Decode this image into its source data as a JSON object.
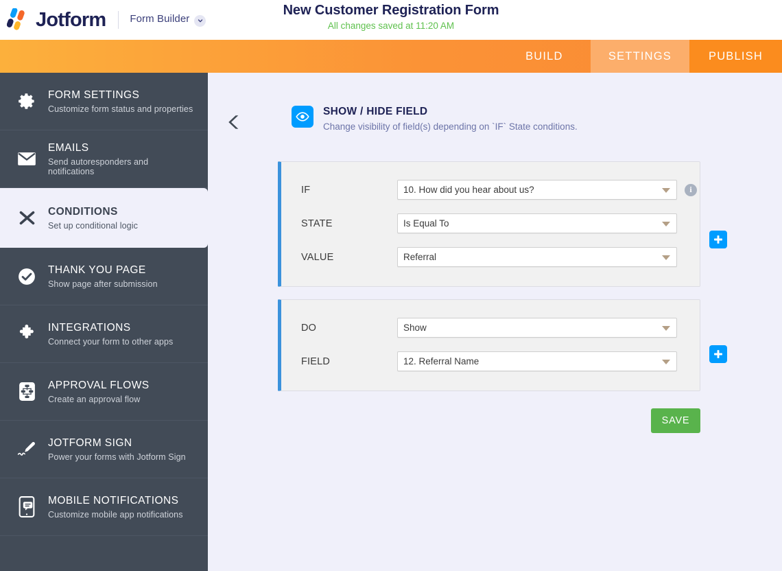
{
  "header": {
    "logo_text": "Jotform",
    "logo_icon": "jotform-logo-icon",
    "builder_label": "Form Builder",
    "builder_chevron_icon": "chevron-down-icon",
    "form_title": "New Customer Registration Form",
    "save_status": "All changes saved at 11:20 AM",
    "status_color": "#5fc14e",
    "title_color": "#1e2255"
  },
  "nav": {
    "tabs": [
      {
        "label": "BUILD",
        "active": false
      },
      {
        "label": "SETTINGS",
        "active": true
      },
      {
        "label": "PUBLISH",
        "active": false
      }
    ],
    "accent_color": "#fb9236",
    "active_tab_color": "#fcae6b"
  },
  "sidebar": {
    "items": [
      {
        "title": "FORM SETTINGS",
        "subtitle": "Customize form status and properties",
        "icon": "gear-icon",
        "active": false
      },
      {
        "title": "EMAILS",
        "subtitle": "Send autoresponders and notifications",
        "icon": "envelope-icon",
        "active": false
      },
      {
        "title": "CONDITIONS",
        "subtitle": "Set up conditional logic",
        "icon": "shuffle-icon",
        "active": true
      },
      {
        "title": "THANK YOU PAGE",
        "subtitle": "Show page after submission",
        "icon": "check-circle-icon",
        "active": false
      },
      {
        "title": "INTEGRATIONS",
        "subtitle": "Connect your form to other apps",
        "icon": "puzzle-piece-icon",
        "active": false
      },
      {
        "title": "APPROVAL FLOWS",
        "subtitle": "Create an approval flow",
        "icon": "flow-chart-icon",
        "active": false
      },
      {
        "title": "JOTFORM SIGN",
        "subtitle": "Power your forms with Jotform Sign",
        "icon": "pen-icon",
        "active": false
      },
      {
        "title": "MOBILE NOTIFICATIONS",
        "subtitle": "Customize mobile app notifications",
        "icon": "mobile-bell-icon",
        "active": false
      }
    ],
    "background": "#424b57",
    "active_background": "#f0f0fa"
  },
  "panel": {
    "back_icon": "back-chevron-icon",
    "rule_icon": "eye-icon",
    "rule_icon_color": "#009cff",
    "title": "SHOW / HIDE FIELD",
    "subtitle": "Change visibility of field(s) depending on `IF` State conditions."
  },
  "condition": {
    "accent_color": "#3b92dc",
    "if_card": {
      "rows": [
        {
          "label": "IF",
          "value": "10. How did you hear about us?",
          "caret_icon": "dropdown-caret-icon",
          "has_info": true
        },
        {
          "label": "STATE",
          "value": "Is Equal To",
          "caret_icon": "dropdown-caret-icon",
          "has_info": false
        },
        {
          "label": "VALUE",
          "value": "Referral",
          "caret_icon": "dropdown-caret-icon",
          "has_info": false
        }
      ],
      "info_icon": "info-icon",
      "add_icon": "plus-icon"
    },
    "do_card": {
      "rows": [
        {
          "label": "DO",
          "value": "Show",
          "caret_icon": "dropdown-caret-icon"
        },
        {
          "label": "FIELD",
          "value": "12. Referral Name",
          "caret_icon": "dropdown-caret-icon"
        }
      ],
      "add_icon": "plus-icon"
    }
  },
  "actions": {
    "save_label": "SAVE",
    "save_color": "#59b34c"
  }
}
